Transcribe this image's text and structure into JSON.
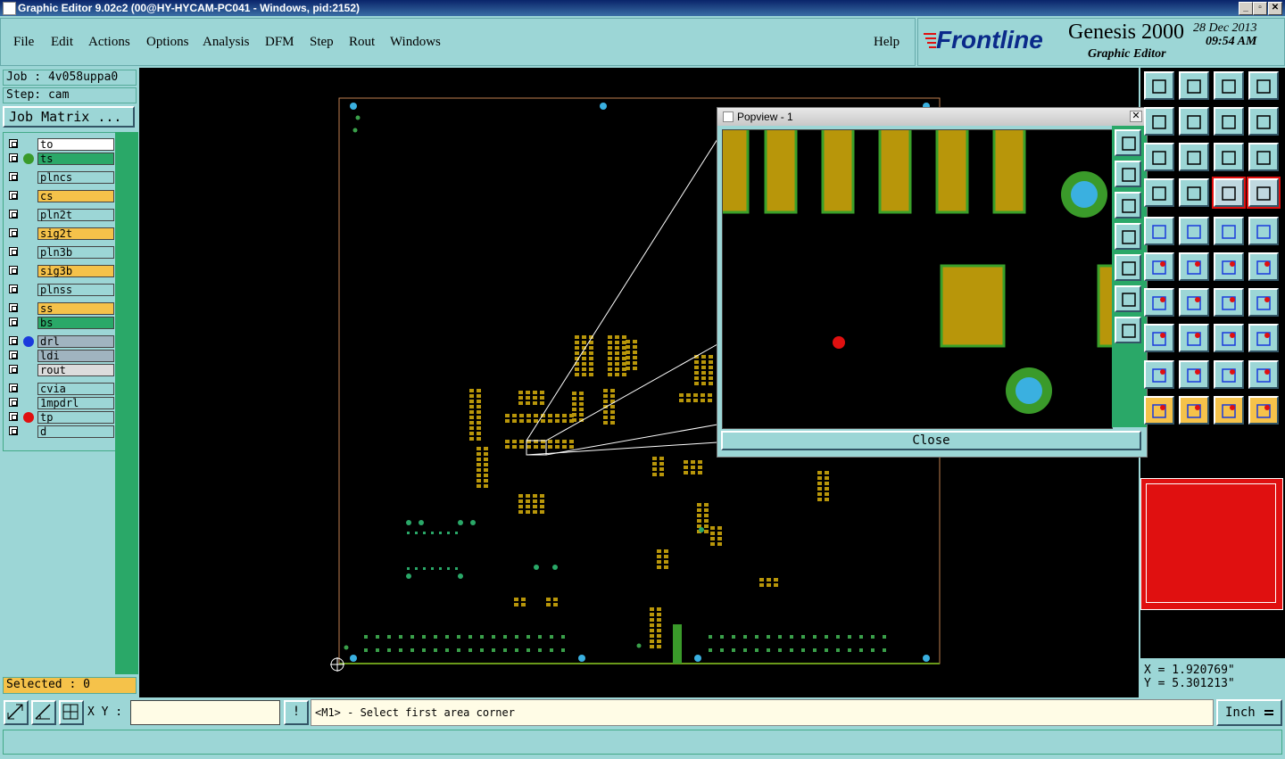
{
  "window": {
    "title": "Graphic Editor 9.02c2 (00@HY-HYCAM-PC041 - Windows, pid:2152)",
    "minimize": "_",
    "maximize": "▫",
    "close": "✕"
  },
  "menu": [
    "File",
    "Edit",
    "Actions",
    "Options",
    "Analysis",
    "DFM",
    "Step",
    "Rout",
    "Windows"
  ],
  "help_label": "Help",
  "brand": {
    "logo": "Frontline",
    "product": "Genesis 2000",
    "subtitle": "Graphic Editor",
    "date": "28 Dec 2013",
    "time": "09:54 AM"
  },
  "job": {
    "job_label": "Job : 4v058uppa0",
    "step_label": "Step: cam",
    "matrix_button": "Job Matrix ..."
  },
  "layers": [
    {
      "name": "to",
      "bg": "#ffffff",
      "dot": ""
    },
    {
      "name": "ts",
      "bg": "#2aa868",
      "dot": "#3a9a2a"
    },
    {
      "name": "plncs",
      "bg": "#9cd6d6",
      "dot": ""
    },
    {
      "name": "cs",
      "bg": "#f5c24a",
      "dot": ""
    },
    {
      "name": "pln2t",
      "bg": "#9cd6d6",
      "dot": ""
    },
    {
      "name": "sig2t",
      "bg": "#f5c24a",
      "dot": ""
    },
    {
      "name": "pln3b",
      "bg": "#9cd6d6",
      "dot": ""
    },
    {
      "name": "sig3b",
      "bg": "#f5c24a",
      "dot": ""
    },
    {
      "name": "plnss",
      "bg": "#9cd6d6",
      "dot": ""
    },
    {
      "name": "ss",
      "bg": "#f5c24a",
      "dot": ""
    },
    {
      "name": "bs",
      "bg": "#2aa868",
      "dot": ""
    },
    {
      "name": "drl",
      "bg": "#a0b4c0",
      "dot": "#1a3adc"
    },
    {
      "name": "ldi",
      "bg": "#a0b4c0",
      "dot": ""
    },
    {
      "name": "rout",
      "bg": "#dcdcdc",
      "dot": ""
    },
    {
      "name": "cvia",
      "bg": "#9cd6d6",
      "dot": ""
    },
    {
      "name": "1mpdrl",
      "bg": "#9cd6d6",
      "dot": ""
    },
    {
      "name": "tp",
      "bg": "#9cd6d6",
      "dot": "#e01010"
    },
    {
      "name": "d",
      "bg": "#9cd6d6",
      "dot": ""
    }
  ],
  "selected_label": "Selected : 0",
  "popview": {
    "title": "Popview - 1",
    "close_button": "Close"
  },
  "coords": {
    "x": "X = 1.920769\"",
    "y": "Y = 5.301213\""
  },
  "status": {
    "xy_label": "X Y :",
    "xy_value": "",
    "message": "<M1> - Select first area corner",
    "units": "Inch",
    "excl": "!"
  },
  "colors": {
    "pad": "#b8960a",
    "pad_edge": "#3aa02a",
    "via": "#3ab0e0",
    "board_outline": "#c08050",
    "highlight": "#e01010"
  }
}
